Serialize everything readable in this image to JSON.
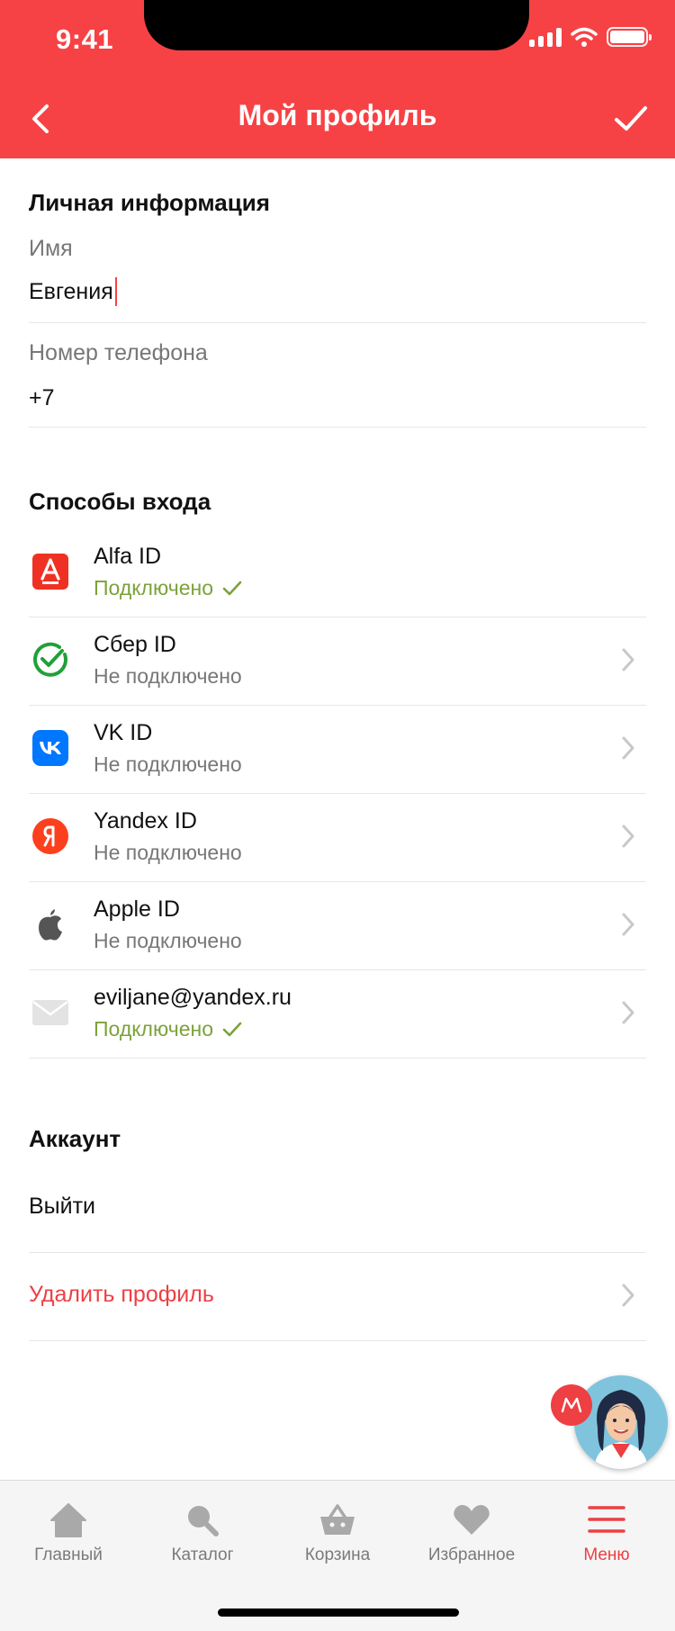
{
  "status_bar": {
    "time": "9:41"
  },
  "nav": {
    "title": "Мой профиль"
  },
  "personal": {
    "section_title": "Личная информация",
    "name_label": "Имя",
    "name_value": "Евгения",
    "phone_label": "Номер телефона",
    "phone_value": "+7"
  },
  "login_methods": {
    "section_title": "Способы входа",
    "items": [
      {
        "name": "Alfa ID",
        "status": "Подключено",
        "connected": true,
        "icon": "alfa-icon"
      },
      {
        "name": "Сбер ID",
        "status": "Не подключено",
        "connected": false,
        "icon": "sber-icon"
      },
      {
        "name": "VK ID",
        "status": "Не подключено",
        "connected": false,
        "icon": "vk-icon"
      },
      {
        "name": "Yandex ID",
        "status": "Не подключено",
        "connected": false,
        "icon": "yandex-icon"
      },
      {
        "name": "Apple ID",
        "status": "Не подключено",
        "connected": false,
        "icon": "apple-icon"
      },
      {
        "name": "eviljane@yandex.ru",
        "status": "Подключено",
        "connected": true,
        "icon": "mail-icon"
      }
    ]
  },
  "account": {
    "section_title": "Аккаунт",
    "logout_label": "Выйти",
    "delete_label": "Удалить профиль"
  },
  "tabbar": {
    "items": [
      {
        "label": "Главный",
        "icon": "home-icon",
        "active": false
      },
      {
        "label": "Каталог",
        "icon": "search-icon",
        "active": false
      },
      {
        "label": "Корзина",
        "icon": "basket-icon",
        "active": false
      },
      {
        "label": "Избранное",
        "icon": "heart-icon",
        "active": false
      },
      {
        "label": "Меню",
        "icon": "menu-icon",
        "active": true
      }
    ]
  },
  "colors": {
    "brand_red": "#f74245",
    "connected_green": "#7ca23a",
    "muted_gray": "#777777",
    "tab_inactive": "#7a7a7a"
  }
}
